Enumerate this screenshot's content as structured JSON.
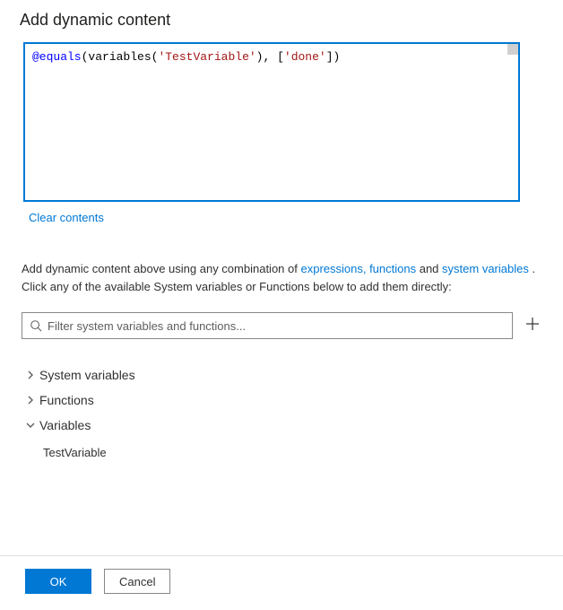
{
  "title": "Add dynamic content",
  "expression": {
    "tokens": [
      {
        "cls": "tok-fn",
        "t": "@equals"
      },
      {
        "cls": "tok-paren",
        "t": "("
      },
      {
        "cls": "tok-call",
        "t": "variables"
      },
      {
        "cls": "tok-paren",
        "t": "("
      },
      {
        "cls": "tok-str",
        "t": "'TestVariable'"
      },
      {
        "cls": "tok-paren",
        "t": ")"
      },
      {
        "cls": "tok-comma",
        "t": ", "
      },
      {
        "cls": "tok-br",
        "t": "["
      },
      {
        "cls": "tok-str",
        "t": "'done'"
      },
      {
        "cls": "tok-br",
        "t": "]"
      },
      {
        "cls": "tok-paren",
        "t": ")"
      }
    ]
  },
  "clear_link": "Clear contents",
  "help": {
    "pre": "Add dynamic content above using any combination of ",
    "link1": "expressions, functions",
    "mid": " and ",
    "link2": "system variables",
    "post1": " . Click any of the available System variables or Functions below to add them directly:"
  },
  "filter": {
    "placeholder": "Filter system variables and functions..."
  },
  "tree": {
    "system_variables": {
      "label": "System variables",
      "expanded": false
    },
    "functions": {
      "label": "Functions",
      "expanded": false
    },
    "variables": {
      "label": "Variables",
      "expanded": true,
      "items": [
        "TestVariable"
      ]
    }
  },
  "buttons": {
    "ok": "OK",
    "cancel": "Cancel"
  }
}
